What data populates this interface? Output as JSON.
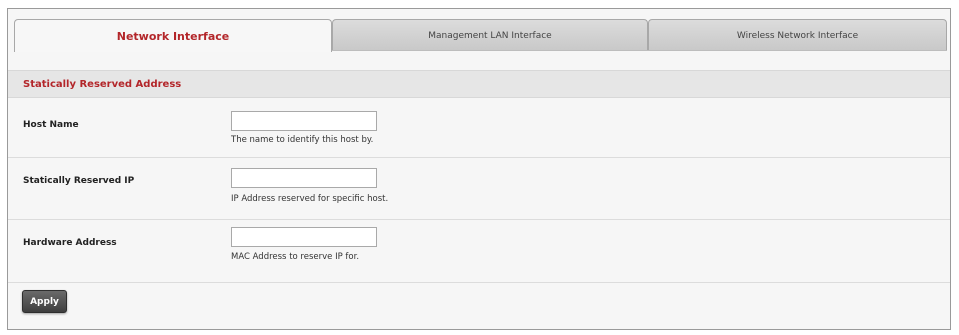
{
  "tabs": [
    {
      "label": "Network Interface",
      "active": true
    },
    {
      "label": "Management LAN Interface",
      "active": false
    },
    {
      "label": "Wireless Network Interface",
      "active": false
    }
  ],
  "section": {
    "title": "Statically Reserved Address"
  },
  "fields": [
    {
      "label": "Host Name",
      "value": "",
      "help": "The name to identify this host by."
    },
    {
      "label": "Statically Reserved IP",
      "value": "",
      "help": "IP Address reserved for specific host."
    },
    {
      "label": "Hardware Address",
      "value": "",
      "help": "MAC Address to reserve IP for."
    }
  ],
  "actions": {
    "apply_label": "Apply"
  },
  "colors": {
    "accent": "#b3262a",
    "button": "#4a4a4a"
  }
}
